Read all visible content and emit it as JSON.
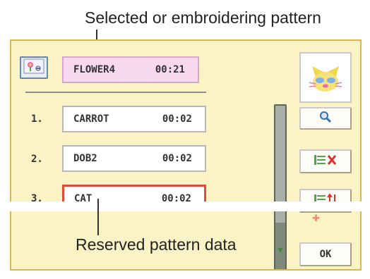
{
  "captions": {
    "top": "Selected or embroidering pattern",
    "bottom": "Reserved pattern data"
  },
  "current_pattern": {
    "name": "FLOWER4",
    "time": "00:21"
  },
  "reserved_patterns": [
    {
      "index": "1.",
      "name": "CARROT",
      "time": "00:02",
      "highlighted": false
    },
    {
      "index": "2.",
      "name": "DOB2",
      "time": "00:02",
      "highlighted": false
    },
    {
      "index": "3.",
      "name": "CAT",
      "time": "00:02",
      "highlighted": true
    }
  ],
  "buttons": {
    "ok": "OK"
  },
  "icons": {
    "selected_pattern": "pattern-thumbnail-icon",
    "preview": "cat-face-icon",
    "zoom": "magnifier-icon",
    "delete": "list-delete-icon",
    "reorder": "list-reorder-icon",
    "scroll_down": "scroll-down-arrow-icon"
  },
  "colors": {
    "panel_bg": "#fbf2c5",
    "current_pattern_bg": "#f9d9ef",
    "highlight_border": "#e24b3b",
    "delete_red": "#e0302a",
    "list_green": "#4fa84a"
  }
}
